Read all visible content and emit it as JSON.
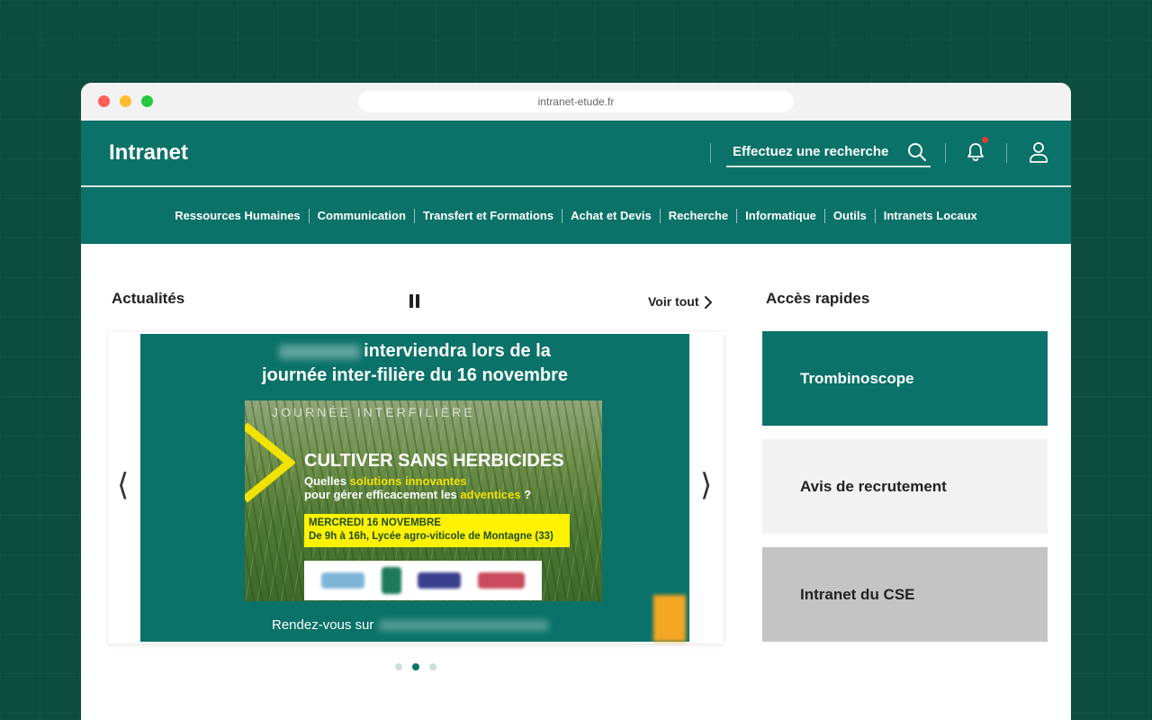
{
  "browser": {
    "url": "intranet-etude.fr"
  },
  "header": {
    "brand": "Intranet",
    "search_placeholder": "Effectuez une recherche"
  },
  "nav": {
    "items": [
      {
        "label": "Ressources Humaines"
      },
      {
        "label": "Communication"
      },
      {
        "label": "Transfert et Formations"
      },
      {
        "label": "Achat et Devis"
      },
      {
        "label": "Recherche"
      },
      {
        "label": "Informatique"
      },
      {
        "label": "Outils"
      },
      {
        "label": "Intranets Locaux"
      }
    ]
  },
  "news": {
    "title": "Actualités",
    "see_all": "Voir tout",
    "slide": {
      "headline_line1": "interviendra lors de la",
      "headline_line2": "journée inter-filière du 16 novembre",
      "poster_top": "JOURNÉE INTERFILIÈRE",
      "poster_title": "CULTIVER SANS HERBICIDES",
      "poster_sub_prefix": "Quelles ",
      "poster_sub_highlight": "solutions innovantes",
      "poster_sub2_prefix": "pour gérer efficacement les ",
      "poster_sub2_highlight": "adventices",
      "poster_sub2_suffix": " ?",
      "poster_date_line1": "MERCREDI 16 NOVEMBRE",
      "poster_date_line2": "De 9h à 16h, Lycée agro-viticole de Montagne (33)",
      "footer": "Rendez-vous sur"
    },
    "dots_count": 3,
    "active_dot": 1
  },
  "quick_access": {
    "title": "Accès rapides",
    "cards": [
      {
        "label": "Trombinoscope"
      },
      {
        "label": "Avis de recrutement"
      },
      {
        "label": "Intranet du CSE"
      }
    ]
  },
  "colors": {
    "primary": "#0a7268",
    "background": "#0c4d3c",
    "accent_yellow": "#fff200",
    "notification": "#e63b2e"
  }
}
